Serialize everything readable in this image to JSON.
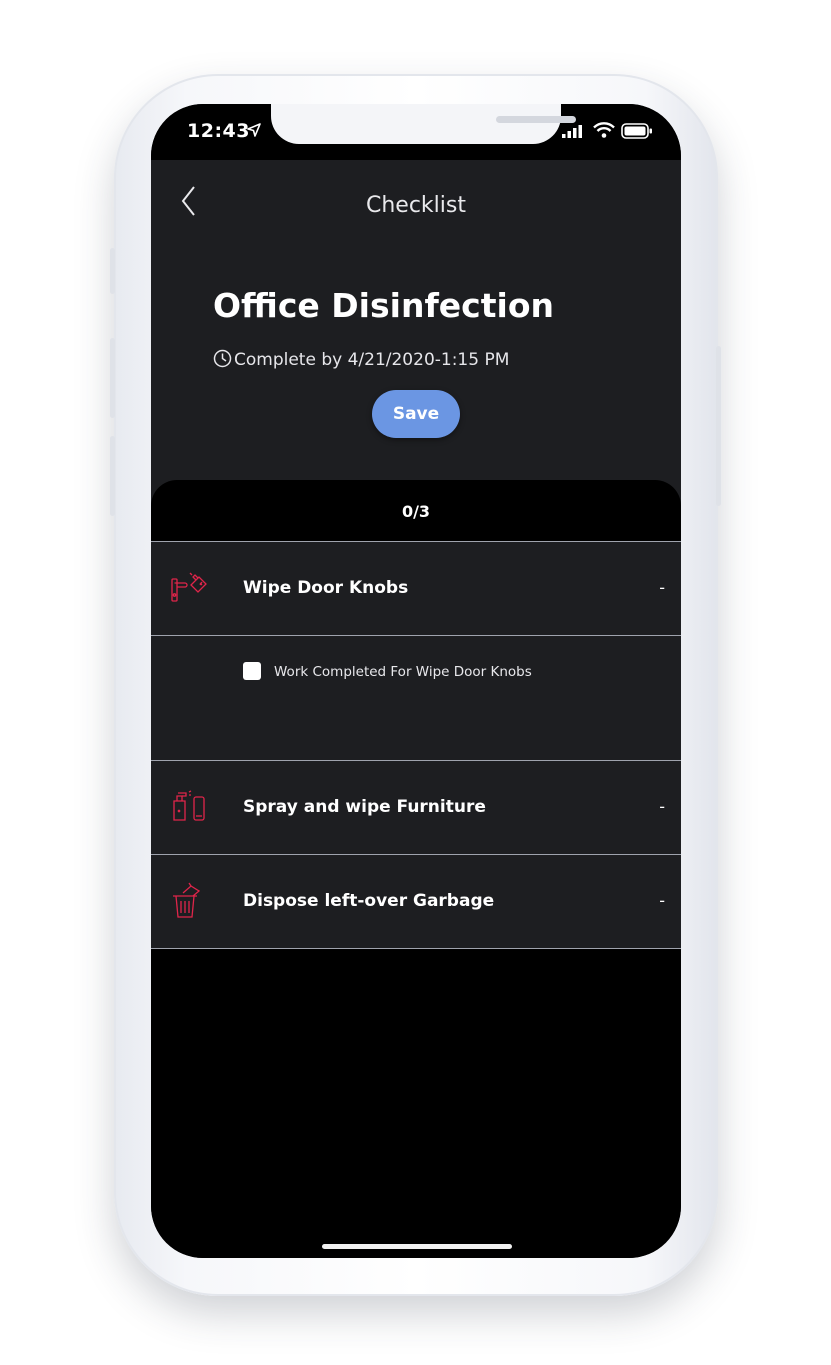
{
  "status_bar": {
    "time": "12:43"
  },
  "nav": {
    "title": "Checklist",
    "back_icon": "chevron-left-icon"
  },
  "header": {
    "title": "Office Disinfection",
    "due_text": "Complete by 4/21/2020-1:15 PM",
    "save_label": "Save"
  },
  "checklist": {
    "progress": "0/3",
    "items": [
      {
        "label": "Wipe Door Knobs",
        "icon": "door-knob-spray-icon",
        "toggle": "-",
        "subtask": {
          "label": "Work Completed For Wipe Door Knobs",
          "checked": false
        }
      },
      {
        "label": "Spray and wipe Furniture",
        "icon": "spray-furniture-icon",
        "toggle": "-"
      },
      {
        "label": "Dispose left-over Garbage",
        "icon": "trash-can-icon",
        "toggle": "-"
      }
    ]
  },
  "colors": {
    "accent": "#6b96e3",
    "icon": "#e0254a",
    "background": "#1d1e21"
  }
}
